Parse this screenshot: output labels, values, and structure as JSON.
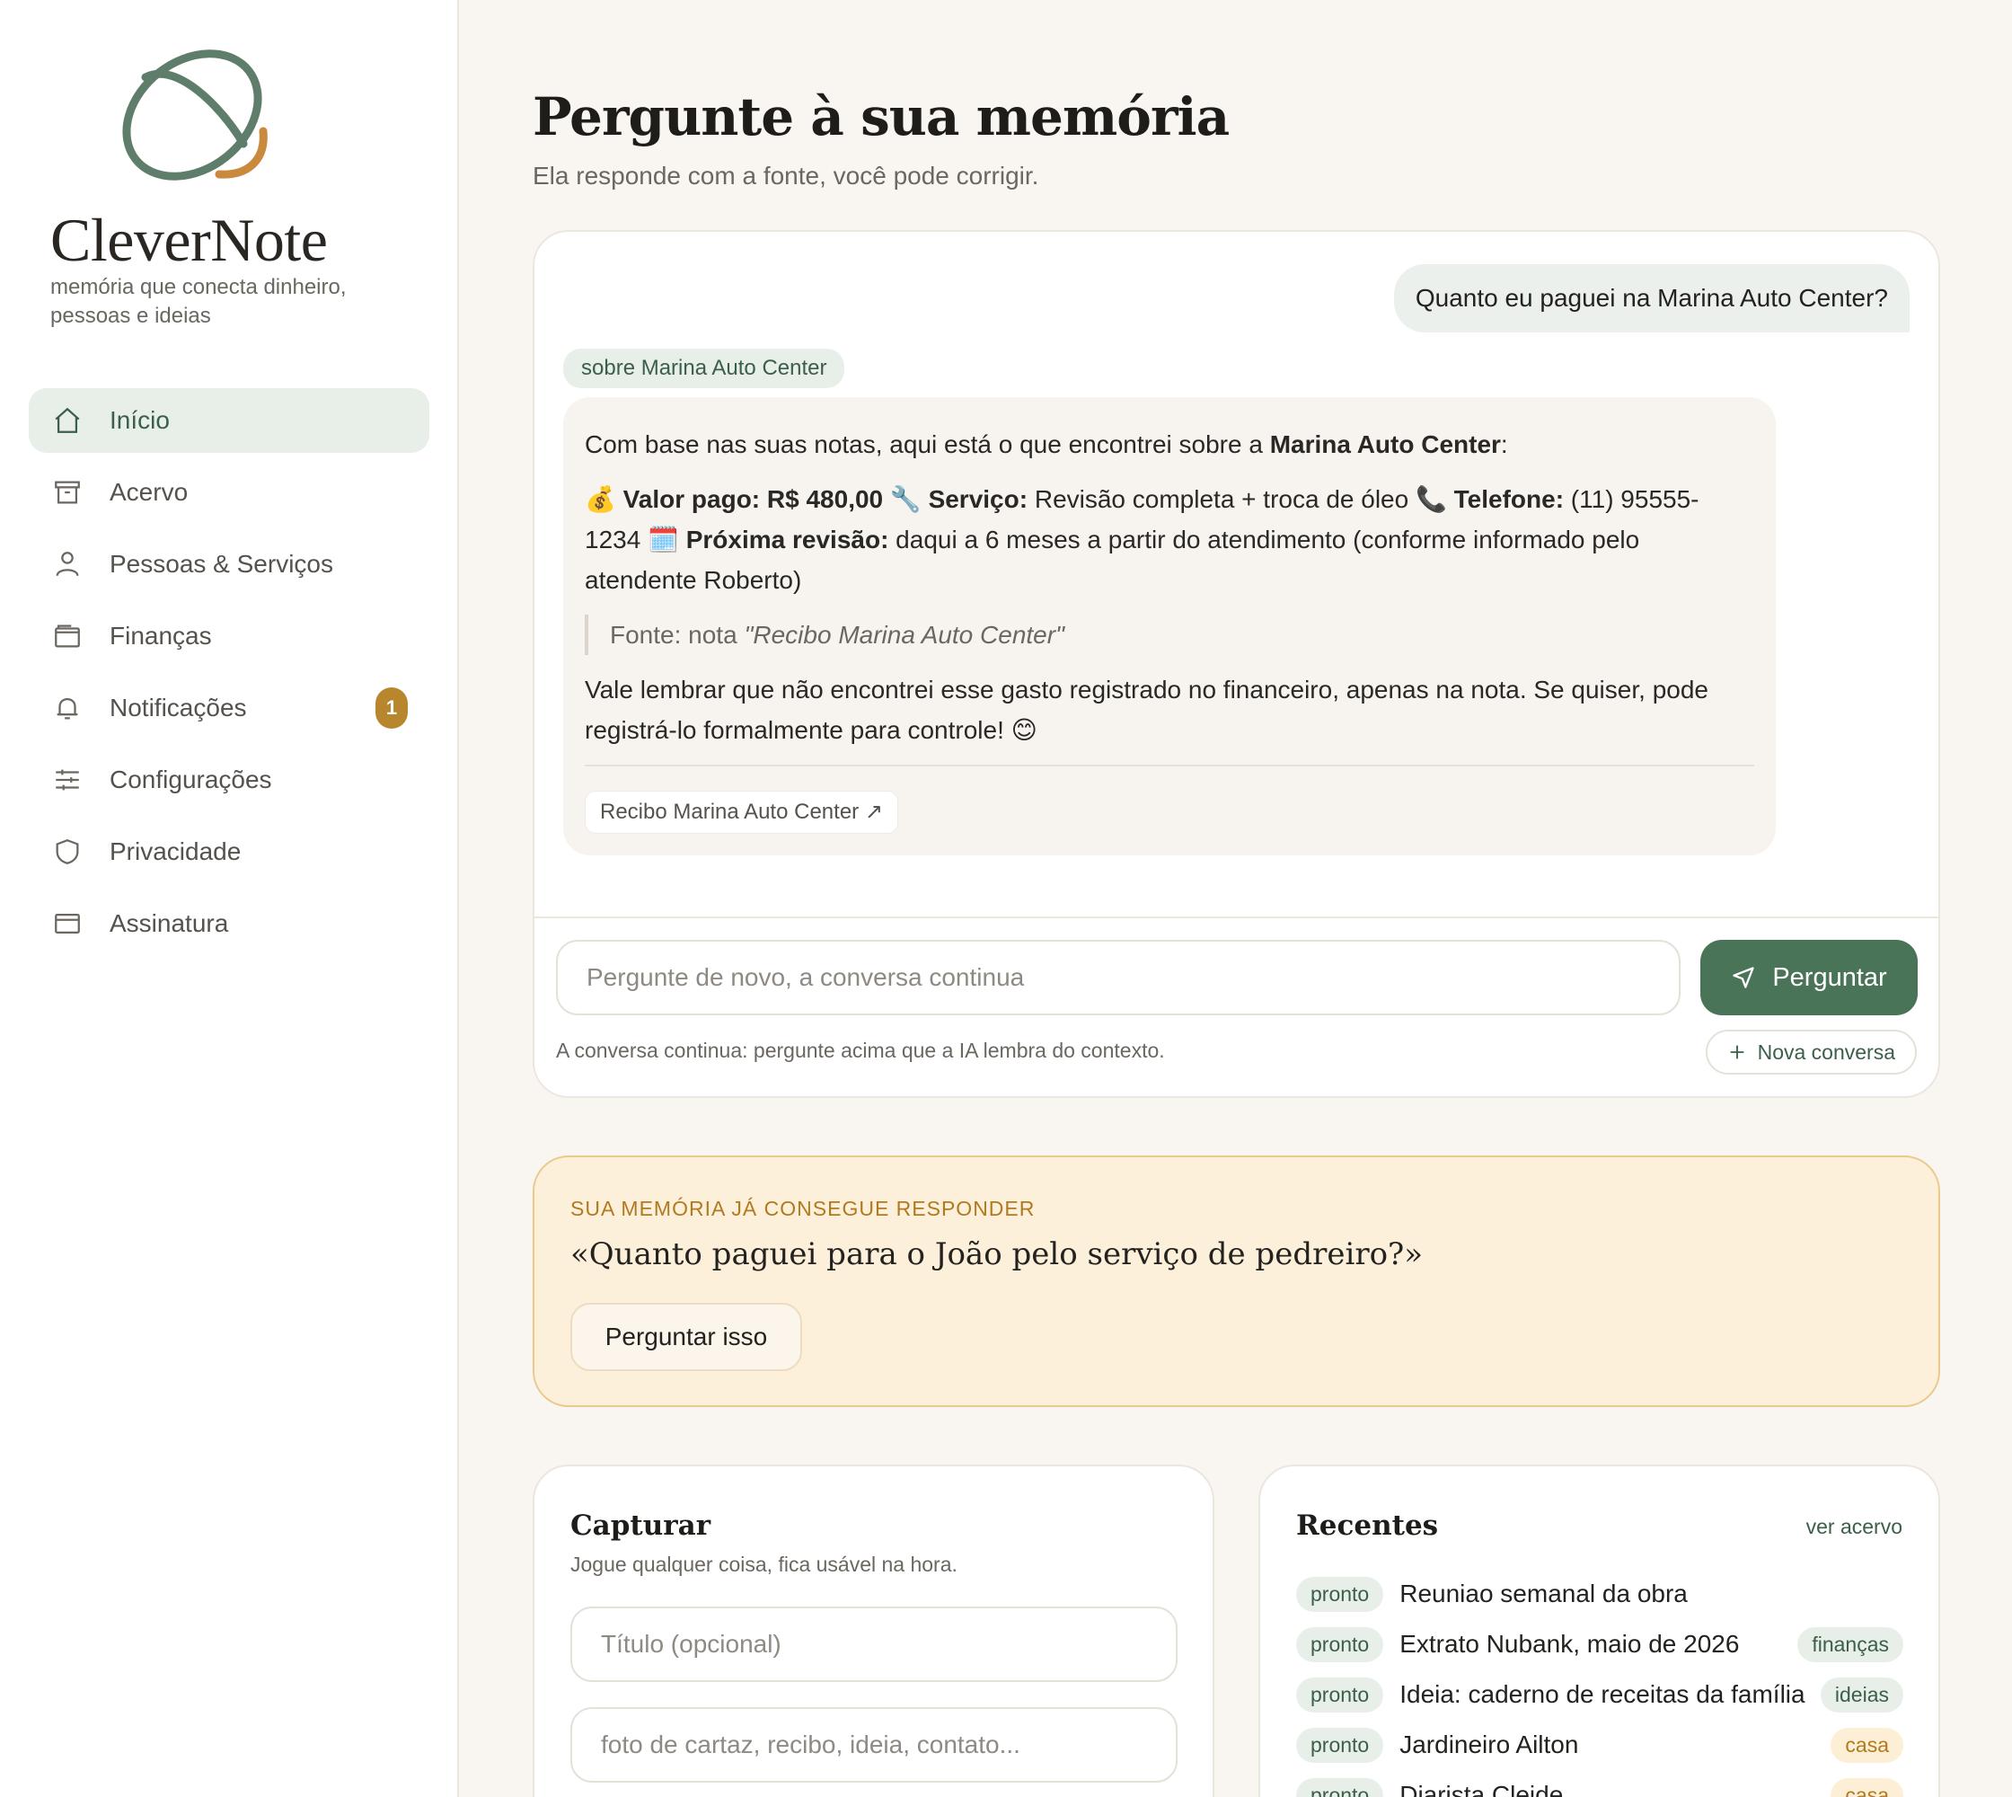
{
  "brand": {
    "name": "CleverNote",
    "tagline": "memória que conecta dinheiro, pessoas e ideias",
    "colors": {
      "green": "#5f7d6b",
      "orange": "#c98a3e"
    }
  },
  "nav": {
    "items": [
      {
        "label": "Início",
        "icon": "home-icon",
        "active": true
      },
      {
        "label": "Acervo",
        "icon": "archive-icon"
      },
      {
        "label": "Pessoas & Serviços",
        "icon": "person-icon"
      },
      {
        "label": "Finanças",
        "icon": "wallet-icon"
      },
      {
        "label": "Notificações",
        "icon": "bell-icon",
        "badge": "1"
      },
      {
        "label": "Configurações",
        "icon": "sliders-icon"
      },
      {
        "label": "Privacidade",
        "icon": "shield-icon"
      },
      {
        "label": "Assinatura",
        "icon": "card-icon"
      }
    ]
  },
  "header": {
    "title": "Pergunte à sua memória",
    "subtitle": "Ela responde com a fonte, você pode corrigir."
  },
  "chat": {
    "user_question": "Quanto eu paguei na Marina Auto Center?",
    "topic_chip": "sobre Marina Auto Center",
    "answer": {
      "intro_prefix": "Com base nas suas notas, aqui está o que encontrei sobre a ",
      "intro_entity": "Marina Auto Center",
      "intro_suffix": ":",
      "money_emoji": "💰",
      "valor_label": "Valor pago: R$ 480,00",
      "wrench_emoji": "🔧",
      "servico_label": "Serviço:",
      "servico_value": " Revisão completa + troca de óleo ",
      "phone_emoji": "📞",
      "telefone_label": "Telefone:",
      "telefone_value": " (11) 95555-1234 ",
      "calendar_emoji": "🗓️",
      "revisao_label": "Próxima revisão:",
      "revisao_value": " daqui a 6 meses a partir do atendimento (conforme informado pelo atendente Roberto)",
      "source_prefix": "Fonte: nota ",
      "source_name": "\"Recibo Marina Auto Center\"",
      "closing": "Vale lembrar que não encontrei esse gasto registrado no financeiro, apenas na nota. Se quiser, pode registrá-lo formalmente para controle! 😊",
      "source_chip": "Recibo Marina Auto Center ↗"
    },
    "input_placeholder": "Pergunte de novo, a conversa continua",
    "ask_button": "Perguntar",
    "hint": "A conversa continua: pergunte acima que a IA lembra do contexto.",
    "new_conversation": "Nova conversa"
  },
  "suggestion": {
    "eyebrow": "SUA MEMÓRIA JÁ CONSEGUE RESPONDER",
    "question": "«Quanto paguei para o João pelo serviço de pedreiro?»",
    "button": "Perguntar isso"
  },
  "capture": {
    "title": "Capturar",
    "subtitle": "Jogue qualquer coisa, fica usável na hora.",
    "title_placeholder": "Título (opcional)",
    "content_placeholder": "foto de cartaz, recibo, ideia, contato..."
  },
  "recent": {
    "title": "Recentes",
    "see_all": "ver acervo",
    "items": [
      {
        "status": "pronto",
        "title": "Reuniao semanal da obra",
        "tag": ""
      },
      {
        "status": "pronto",
        "title": "Extrato Nubank, maio de 2026",
        "tag": "finanças"
      },
      {
        "status": "pronto",
        "title": "Ideia: caderno de receitas da família",
        "tag": "ideias"
      },
      {
        "status": "pronto",
        "title": "Jardineiro Ailton",
        "tag": "casa"
      },
      {
        "status": "pronto",
        "title": "Diarista Cleide",
        "tag": "casa"
      }
    ]
  }
}
